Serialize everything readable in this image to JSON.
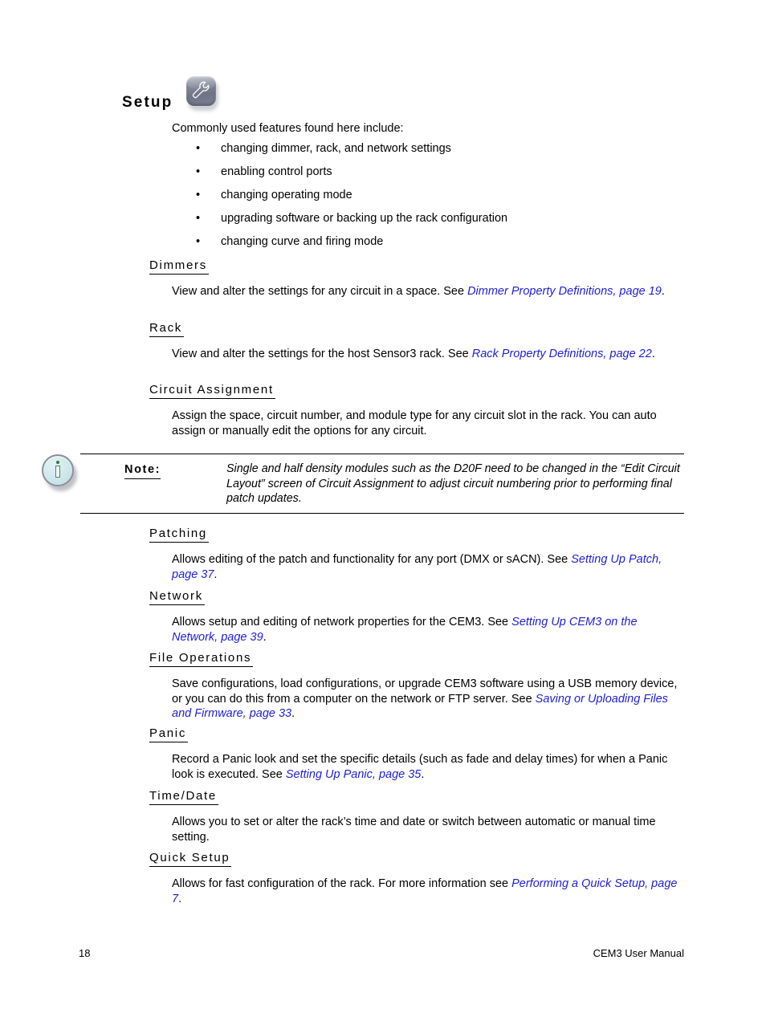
{
  "page": {
    "title": "Setup",
    "title_icon": "wrench-icon",
    "lead": "Commonly used features found here include:",
    "bullet_marker": "•",
    "bullets": [
      "changing dimmer, rack, and network settings",
      "enabling control ports",
      "changing operating mode",
      "upgrading software or backing up the rack configuration",
      "changing curve and firing mode"
    ]
  },
  "sections": [
    {
      "heading": "Dimmers",
      "body_pre": "View and alter the settings for any circuit in a space. See ",
      "xref": "Dimmer Property Definitions, page 19",
      "body_post": "."
    },
    {
      "heading": "Rack",
      "body_pre": "View and alter the settings for the host Sensor3 rack. See ",
      "xref": "Rack Property Definitions, page 22",
      "body_post": "."
    },
    {
      "heading": "Circuit Assignment",
      "body_pre": "Assign the space, circuit number, and module type for any circuit slot in the rack. You can auto assign or manually edit the options for any circuit.",
      "xref": "",
      "body_post": ""
    },
    {
      "heading": "Patching",
      "body_pre": "Allows editing of the patch and functionality for any port (DMX or sACN). See ",
      "xref": "Setting Up Patch, page 37",
      "body_post": "."
    },
    {
      "heading": "Network",
      "body_pre": "Allows setup and editing of network properties for the CEM3. See ",
      "xref": "Setting Up CEM3 on the Network, page 39",
      "body_post": "."
    },
    {
      "heading": "File Operations",
      "body_pre": "Save configurations, load configurations, or upgrade CEM3 software using a USB memory device, or you can do this from a computer on the network or FTP server. See ",
      "xref": "Saving or Uploading Files and Firmware, page 33",
      "body_post": "."
    },
    {
      "heading": "Panic",
      "body_pre": "Record a Panic look and set the specific details (such as fade and delay times) for when a Panic look is executed. See ",
      "xref": "Setting Up Panic, page 35",
      "body_post": "."
    },
    {
      "heading": "Time/Date",
      "body_pre": "Allows you to set or alter the rack’s time and date or switch between automatic or manual time setting.",
      "xref": "",
      "body_post": ""
    },
    {
      "heading": "Quick Setup",
      "body_pre": "Allows for fast configuration of the rack. For more information see ",
      "xref": "Performing a Quick Setup, page 7",
      "body_post": "."
    }
  ],
  "note": {
    "icon": "info-icon",
    "label": "Note:",
    "text": "Single and half density modules such as the D20F need to be changed in the “Edit Circuit Layout” screen of Circuit Assignment to adjust circuit numbering prior to performing final patch updates."
  },
  "footer": {
    "page_number": "18",
    "manual_title": "CEM3 User Manual"
  },
  "colors": {
    "xref_blue": "#1f1fd0",
    "text_black": "#000000",
    "page_background": "#ffffff"
  }
}
